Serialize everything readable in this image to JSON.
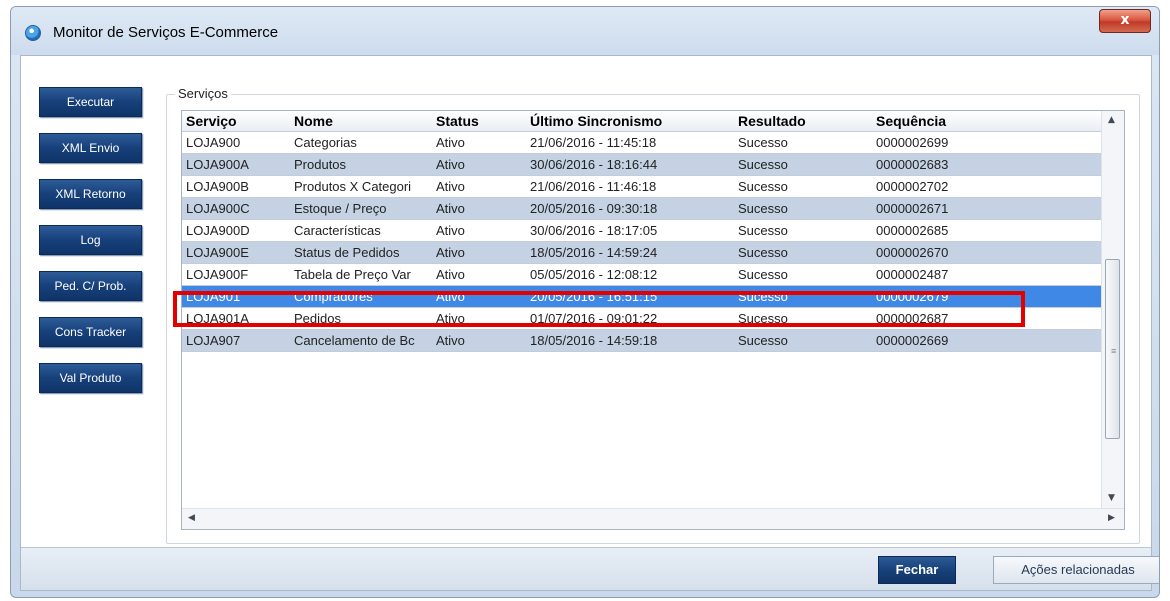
{
  "window": {
    "title": "Monitor de Serviços E-Commerce",
    "close_label": "x"
  },
  "sidebar": {
    "buttons": [
      {
        "label": "Executar"
      },
      {
        "label": "XML Envio"
      },
      {
        "label": "XML Retorno"
      },
      {
        "label": "Log"
      },
      {
        "label": "Ped. C/ Prob."
      },
      {
        "label": "Cons Tracker"
      },
      {
        "label": "Val Produto"
      }
    ]
  },
  "services": {
    "group_label": "Serviços",
    "columns": [
      "Serviço",
      "Nome",
      "Status",
      "Último Sincronismo",
      "Resultado",
      "Sequência"
    ],
    "rows": [
      [
        "LOJA900",
        "Categorias",
        "Ativo",
        "21/06/2016 - 11:45:18",
        "Sucesso",
        "0000002699"
      ],
      [
        "LOJA900A",
        "Produtos",
        "Ativo",
        "30/06/2016 - 18:16:44",
        "Sucesso",
        "0000002683"
      ],
      [
        "LOJA900B",
        "Produtos X Categori",
        "Ativo",
        "21/06/2016 - 11:46:18",
        "Sucesso",
        "0000002702"
      ],
      [
        "LOJA900C",
        "Estoque / Preço",
        "Ativo",
        "20/05/2016 - 09:30:18",
        "Sucesso",
        "0000002671"
      ],
      [
        "LOJA900D",
        "Características",
        "Ativo",
        "30/06/2016 - 18:17:05",
        "Sucesso",
        "0000002685"
      ],
      [
        "LOJA900E",
        "Status de Pedidos",
        "Ativo",
        "18/05/2016 - 14:59:24",
        "Sucesso",
        "0000002670"
      ],
      [
        "LOJA900F",
        "Tabela de Preço Var",
        "Ativo",
        "05/05/2016 - 12:08:12",
        "Sucesso",
        "0000002487"
      ],
      [
        "LOJA901",
        "Compradores",
        "Ativo",
        "20/05/2016 - 16:51:15",
        "Sucesso",
        "0000002679"
      ],
      [
        "LOJA901A",
        "Pedidos",
        "Ativo",
        "01/07/2016 - 09:01:22",
        "Sucesso",
        "0000002687"
      ],
      [
        "LOJA907",
        "Cancelamento de Bc",
        "Ativo",
        "18/05/2016 - 14:59:18",
        "Sucesso",
        "0000002669"
      ]
    ],
    "selected_row": 7
  },
  "footer": {
    "close_label": "Fechar",
    "actions_label": "Ações relacionadas"
  },
  "colors": {
    "selected_row": "#3f88e6",
    "alt_row": "#c4d2e4",
    "highlight_box": "#e50000",
    "primary_button": "#173f78"
  },
  "icons": {
    "app": "globe-icon",
    "scroll_up": "arrow-up-icon",
    "scroll_down": "arrow-down-icon",
    "scroll_left": "arrow-left-icon",
    "scroll_right": "arrow-right-icon"
  }
}
